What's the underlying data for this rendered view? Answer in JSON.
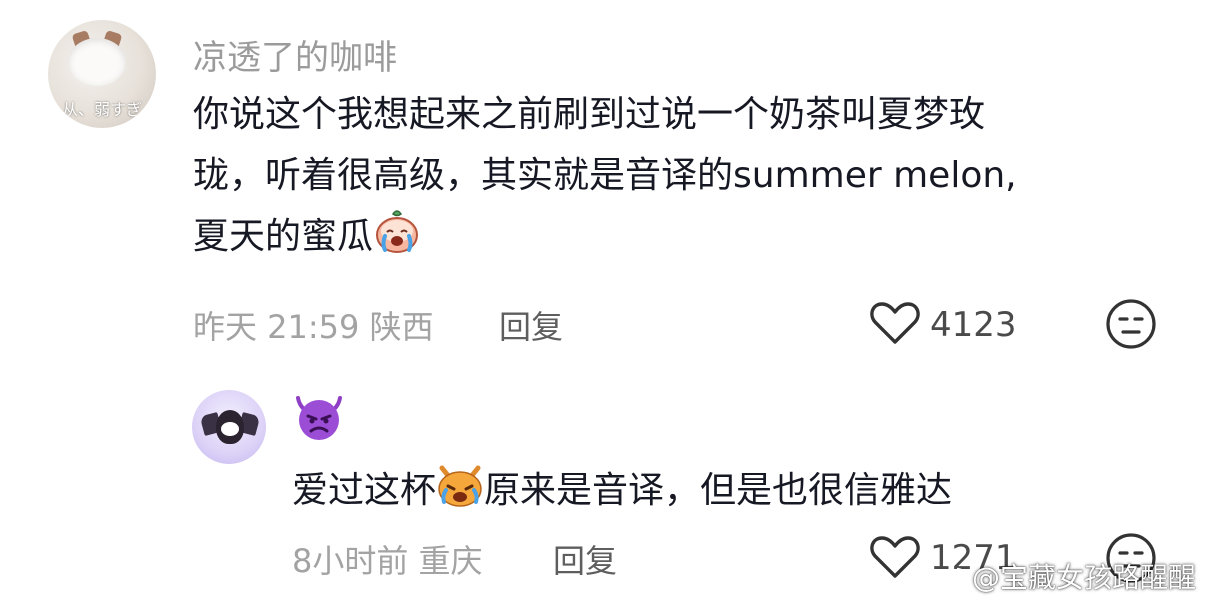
{
  "comments": [
    {
      "username": "凉透了的咖啡",
      "avatar_text": "从、弱すぎ",
      "text_part1": "你说这个我想起来之前刷到过说一个奶茶叫夏梦玫",
      "text_part2": "珑，听着很高级，其实就是音译的summer melon,",
      "text_part3": "夏天的蜜瓜",
      "time": "昨天 21:59",
      "location": "陕西",
      "reply_label": "回复",
      "likes": "4123",
      "emoji_name": "crying-cake-emoji"
    },
    {
      "username_emoji": "😈",
      "text_before": "爱过这杯",
      "text_after": "原来是音译，但是也很信雅达",
      "time": "8小时前",
      "location": "重庆",
      "reply_label": "回复",
      "likes": "1271",
      "emoji_name": "crying-cat-emoji"
    }
  ],
  "watermark": "@宝藏女孩路醒醒",
  "icons": {
    "like": "heart-outline-icon",
    "dislike": "neutral-face-icon",
    "watermark_logo": "weibo-icon"
  },
  "colors": {
    "text": "#161823",
    "muted": "#a3a3a3",
    "username": "#9b9b9b"
  }
}
